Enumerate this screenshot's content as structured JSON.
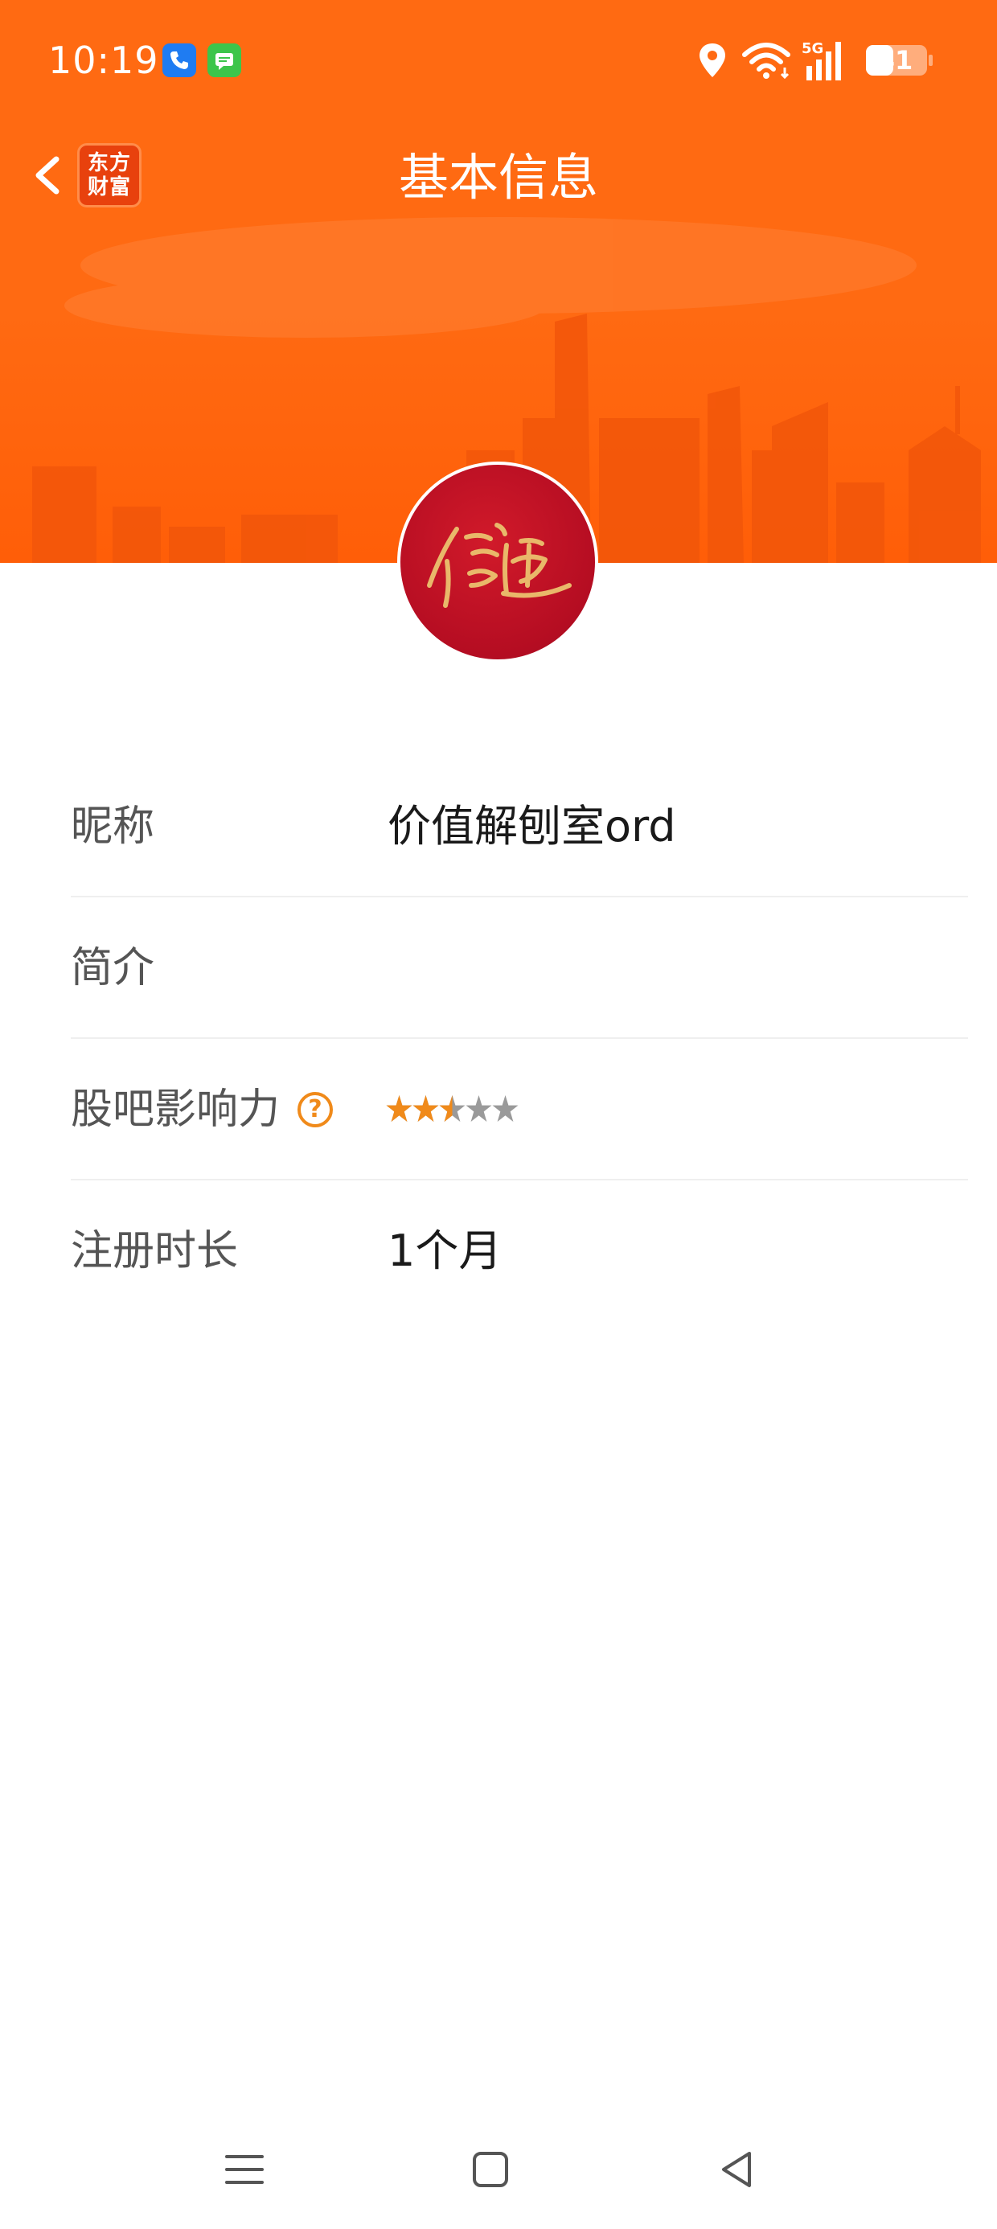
{
  "status_bar": {
    "time": "10:19",
    "battery": "41",
    "network": "5G",
    "icons": [
      "phone-app-icon",
      "message-app-icon",
      "location-icon",
      "wifi-icon",
      "signal-icon",
      "battery-icon"
    ]
  },
  "header": {
    "title": "基本信息",
    "logo_line1": "东方",
    "logo_line2": "财富",
    "back_icon": "chevron-left-icon"
  },
  "profile": {
    "fields": [
      {
        "label": "昵称",
        "value": "价值解刨室ord"
      },
      {
        "label": "简介",
        "value": ""
      },
      {
        "label": "股吧影响力",
        "help_mark": "?",
        "stars_total": 5,
        "stars_filled": 2.5
      },
      {
        "label": "注册时长",
        "value": "1个月"
      }
    ]
  },
  "colors": {
    "accent": "#ff6a12",
    "avatar_red": "#b50d22",
    "star_filled": "#f08a1a",
    "star_empty": "#9a9a9a",
    "label_text": "#555555",
    "value_text": "#1a1a1a"
  },
  "system_nav": {
    "icons": [
      "menu-icon",
      "home-icon",
      "back-triangle-icon"
    ]
  }
}
